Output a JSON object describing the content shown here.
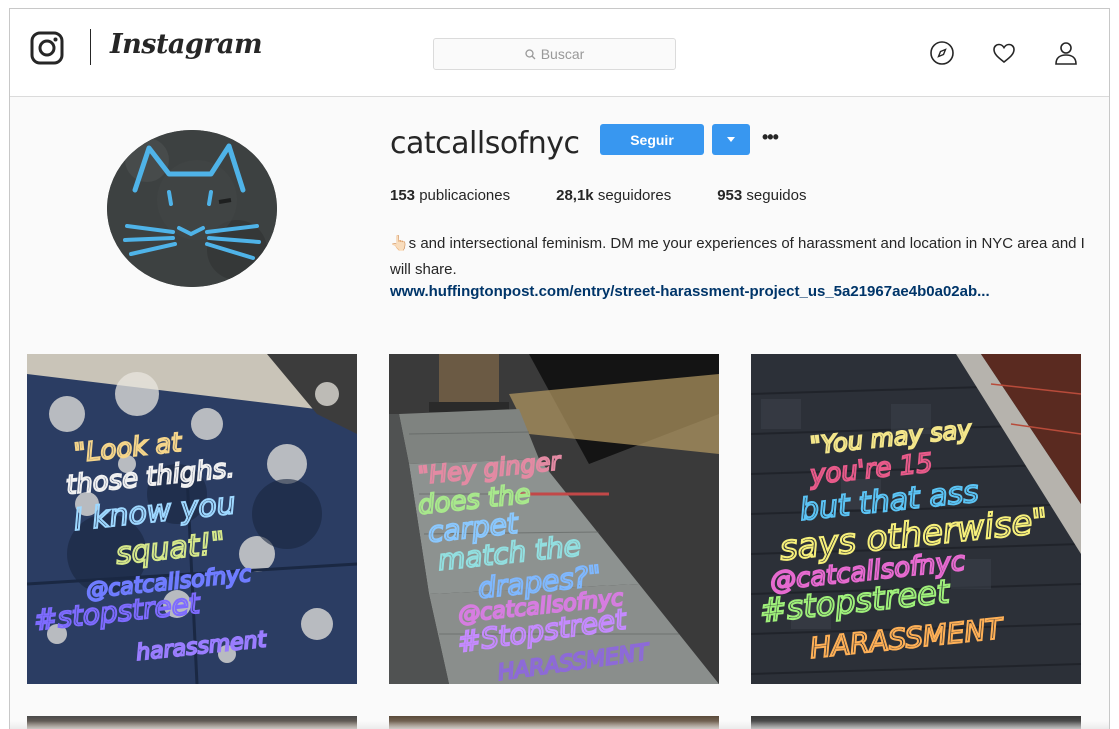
{
  "header": {
    "wordmark": "Instagram",
    "search_placeholder": "Buscar"
  },
  "profile": {
    "username": "catcallsofnyc",
    "follow_label": "Seguir",
    "stats": {
      "posts_count": "153",
      "posts_label": "publicaciones",
      "followers_count": "28,1k",
      "followers_label": "seguidores",
      "following_count": "953",
      "following_label": "seguidos"
    },
    "bio": "👆🏻s and intersectional feminism. DM me your experiences of harassment and location in NYC area and I will share.",
    "link": "www.huffingtonpost.com/entry/street-harassment-project_us_5a21967ae4b0a02ab..."
  },
  "posts": [
    {
      "caption": "\"Look at those thighs. I know you squat!\" @catcallsofnyc #stopstreet harassment"
    },
    {
      "caption": "\"Hey ginger does the carpet match the drapes?\" @catcallsofnyc #Stopstreet HARASSMENT"
    },
    {
      "caption": "\"You may say you're 15 but that ass says otherwise\" @catcallsofnyc #stopstreet HARASSMENT"
    }
  ],
  "colors": {
    "accent": "#3897f0",
    "link": "#003569",
    "text": "#262626"
  }
}
